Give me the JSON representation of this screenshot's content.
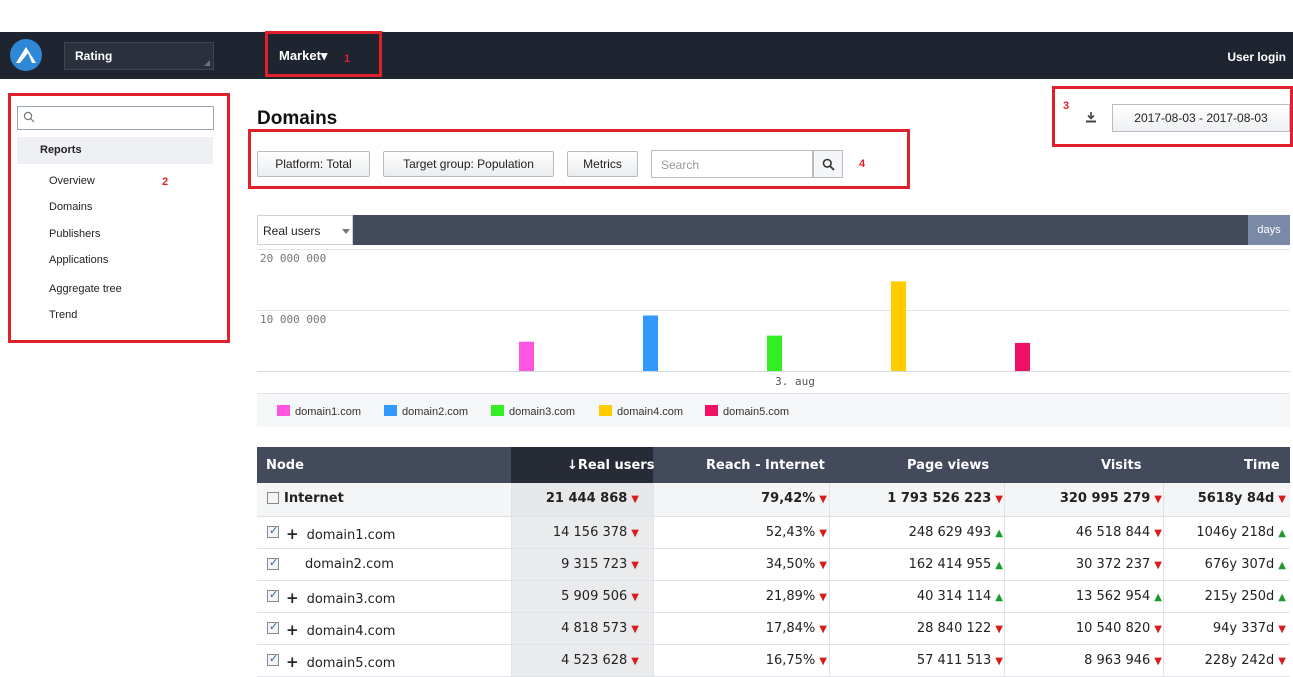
{
  "topbar": {
    "logo_icon": "triangle-logo-icon",
    "rating_select": "Rating",
    "market_menu": "Market▾",
    "user_login": "User login"
  },
  "annotations": [
    "1",
    "2",
    "3",
    "4"
  ],
  "sidebar": {
    "search_placeholder": "",
    "section": "Reports",
    "items": [
      "Overview",
      "Domains",
      "Publishers",
      "Applications",
      "Aggregate tree",
      "Trend"
    ]
  },
  "main": {
    "title": "Domains",
    "date_range": "2017-08-03 - 2017-08-03",
    "filters": {
      "platform": "Platform: Total",
      "target_group": "Target group: Population",
      "metrics": "Metrics",
      "search_placeholder": "Search"
    }
  },
  "chart_panel": {
    "metric_select": "Real users",
    "period_label": "days"
  },
  "chart_data": {
    "type": "bar",
    "categories": [
      "3. aug"
    ],
    "series": [
      {
        "name": "domain1.com",
        "values": [
          4800000
        ],
        "color": "#ff55e0"
      },
      {
        "name": "domain2.com",
        "values": [
          9100000
        ],
        "color": "#3399ff"
      },
      {
        "name": "domain3.com",
        "values": [
          5800000
        ],
        "color": "#33ee22"
      },
      {
        "name": "domain4.com",
        "values": [
          14700000
        ],
        "color": "#ffcc00"
      },
      {
        "name": "domain5.com",
        "values": [
          4600000
        ],
        "color": "#ee1166"
      }
    ],
    "y_ticks": [
      "20 000 000",
      "10 000 000"
    ],
    "ylim": [
      0,
      20000000
    ],
    "grid": true,
    "legend": "bottom"
  },
  "table": {
    "headers": [
      "Node",
      "↓Real users",
      "Reach - Internet",
      "Page views",
      "Visits",
      "Time"
    ],
    "total_row": {
      "node": "Internet",
      "real_users": "21 444 868",
      "reach": "79,42%",
      "page_views": "1 793 526 223",
      "visits": "320 995 279",
      "time": "5618y 84d",
      "trends": [
        "down",
        "down",
        "down",
        "down",
        "down"
      ]
    },
    "rows": [
      {
        "expand": "+",
        "node": "domain1.com",
        "real_users": "14 156 378",
        "reach": "52,43%",
        "page_views": "248 629 493",
        "visits": "46 518 844",
        "time": "1046y 218d",
        "trends": [
          "down",
          "down",
          "up",
          "down",
          "up"
        ]
      },
      {
        "expand": "",
        "node": "domain2.com",
        "real_users": "9 315 723",
        "reach": "34,50%",
        "page_views": "162 414 955",
        "visits": "30 372 237",
        "time": "676y 307d",
        "trends": [
          "down",
          "down",
          "up",
          "down",
          "up"
        ]
      },
      {
        "expand": "+",
        "node": "domain3.com",
        "real_users": "5 909 506",
        "reach": "21,89%",
        "page_views": "40 314 114",
        "visits": "13 562 954",
        "time": "215y 250d",
        "trends": [
          "down",
          "down",
          "up",
          "up",
          "up"
        ]
      },
      {
        "expand": "+",
        "node": "domain4.com",
        "real_users": "4 818 573",
        "reach": "17,84%",
        "page_views": "28 840 122",
        "visits": "10 540 820",
        "time": "94y 337d",
        "trends": [
          "down",
          "down",
          "down",
          "down",
          "down"
        ]
      },
      {
        "expand": "+",
        "node": "domain5.com",
        "real_users": "4 523 628",
        "reach": "16,75%",
        "page_views": "57 411 513",
        "visits": "8 963 946",
        "time": "228y 242d",
        "trends": [
          "down",
          "down",
          "down",
          "down",
          "down"
        ]
      }
    ]
  }
}
